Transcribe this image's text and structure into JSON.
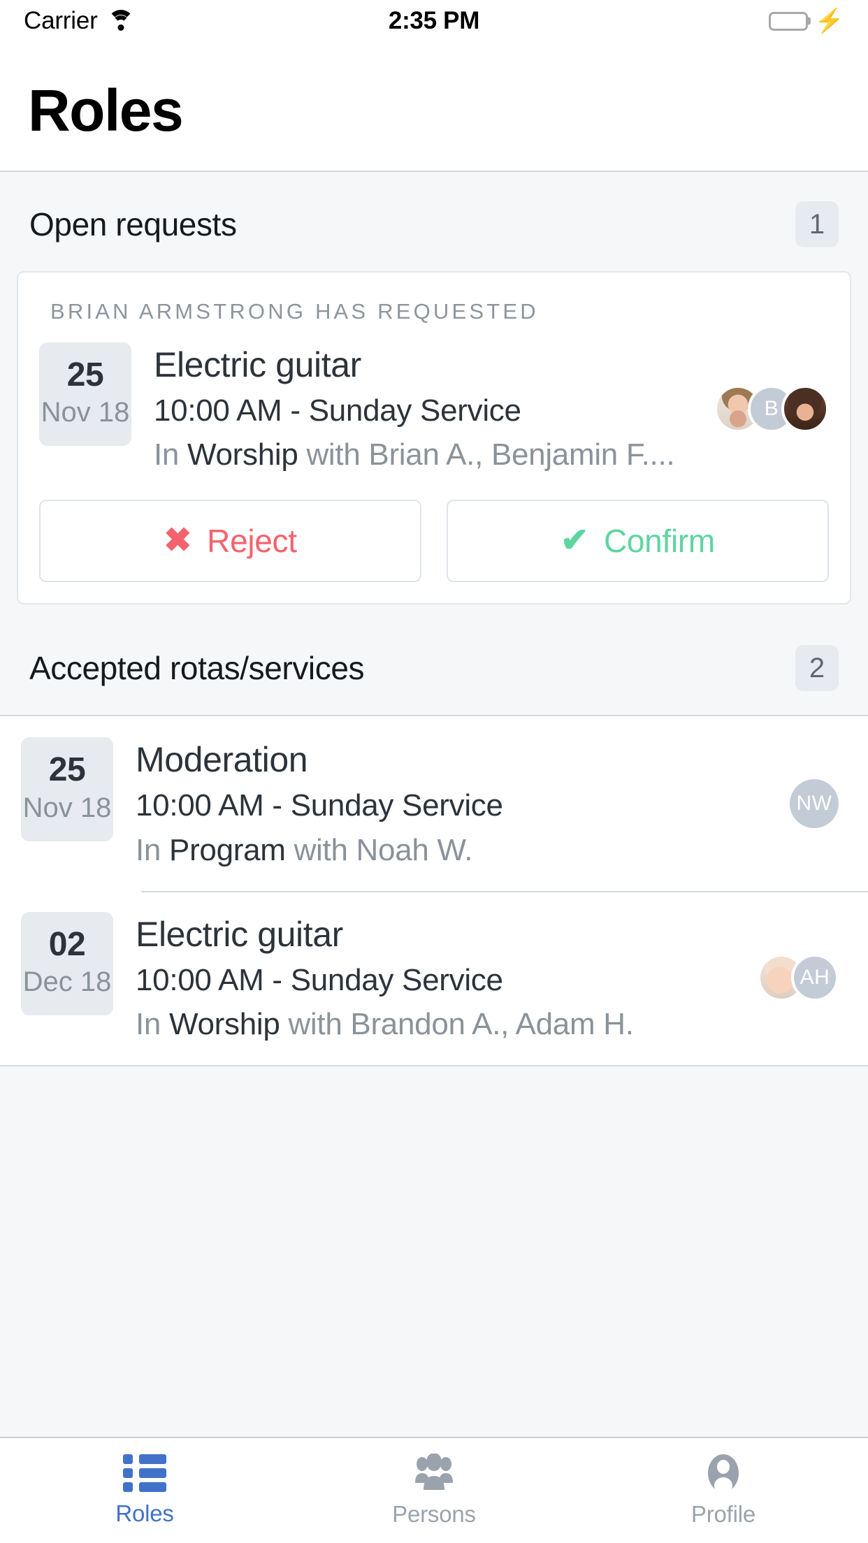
{
  "status_bar": {
    "carrier": "Carrier",
    "wifi_icon": "wifi-icon",
    "time": "2:35 PM",
    "battery_icon": "battery-icon",
    "charging_icon": "lightning-bolt-icon",
    "battery_color": "#4cd964"
  },
  "header": {
    "title": "Roles"
  },
  "open_requests": {
    "section_label": "Open requests",
    "count": "1",
    "card": {
      "kicker": "BRIAN ARMSTRONG HAS REQUESTED",
      "date_day": "25",
      "date_month": "Nov 18",
      "title": "Electric guitar",
      "subtitle": "10:00 AM - Sunday Service",
      "meta_prefix": "In ",
      "meta_group": "Worship",
      "meta_people": " with Brian A., Benjamin F....",
      "avatars": [
        {
          "type": "photo",
          "style": "ph-man",
          "name": "brian-armstrong-avatar",
          "initials": ""
        },
        {
          "type": "initials",
          "style": "",
          "name": "benjamin-f-avatar",
          "initials": "B"
        },
        {
          "type": "photo",
          "style": "ph-woman",
          "name": "member-avatar",
          "initials": ""
        }
      ],
      "reject_label": "Reject",
      "reject_icon": "cross-icon",
      "reject_color": "#f4626e",
      "confirm_label": "Confirm",
      "confirm_icon": "check-icon",
      "confirm_color": "#5ed5a0"
    }
  },
  "accepted": {
    "section_label": "Accepted rotas/services",
    "count": "2",
    "items": [
      {
        "date_day": "25",
        "date_month": "Nov 18",
        "title": "Moderation",
        "subtitle": "10:00 AM - Sunday Service",
        "meta_prefix": "In ",
        "meta_group": "Program",
        "meta_people": " with Noah W.",
        "avatars": [
          {
            "type": "initials",
            "style": "",
            "name": "noah-w-avatar",
            "initials": "NW"
          }
        ]
      },
      {
        "date_day": "02",
        "date_month": "Dec 18",
        "title": "Electric guitar",
        "subtitle": "10:00 AM - Sunday Service",
        "meta_prefix": "In ",
        "meta_group": "Worship",
        "meta_people": " with Brandon A., Adam H.",
        "avatars": [
          {
            "type": "photo",
            "style": "ph-baby",
            "name": "brandon-a-avatar",
            "initials": ""
          },
          {
            "type": "initials",
            "style": "",
            "name": "adam-h-avatar",
            "initials": "AH"
          }
        ]
      }
    ]
  },
  "tabbar": {
    "active_color": "#4072ca",
    "inactive_color": "#9aa3ad",
    "tabs": [
      {
        "label": "Roles",
        "icon": "list-icon",
        "active": true
      },
      {
        "label": "Persons",
        "icon": "people-group-icon",
        "active": false
      },
      {
        "label": "Profile",
        "icon": "person-circle-icon",
        "active": false
      }
    ]
  }
}
